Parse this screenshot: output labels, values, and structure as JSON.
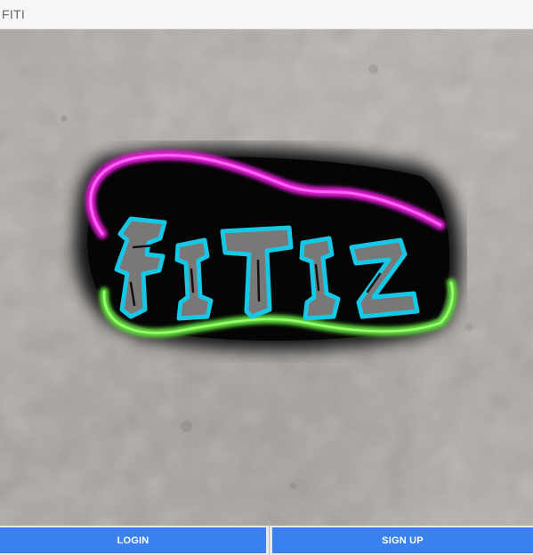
{
  "window": {
    "title": "FITI"
  },
  "splash": {
    "logo_text": "FITI",
    "logo_colors": {
      "outline": "#17c8e6",
      "fill": "#7a7876",
      "top_glow": "#e21ed6",
      "bottom_glow": "#5edc3a",
      "backdrop": "#050505"
    }
  },
  "actions": {
    "login_label": "LOGIN",
    "signup_label": "SIGN UP",
    "button_color": "#3a80ee"
  }
}
